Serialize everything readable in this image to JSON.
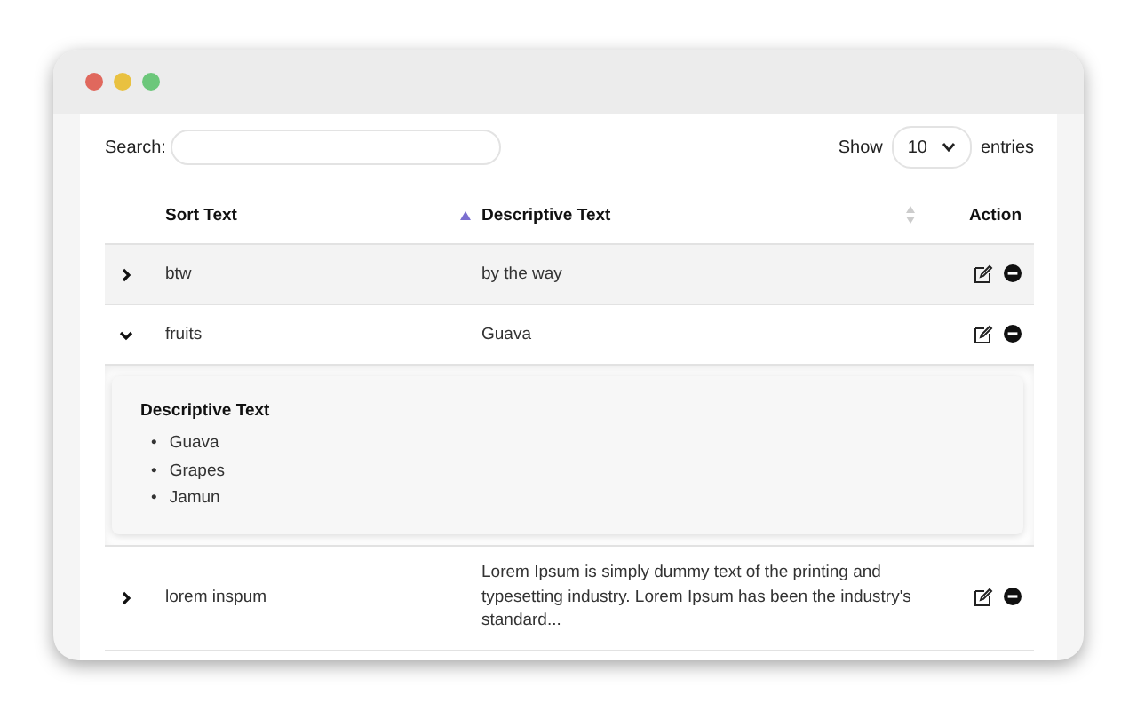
{
  "search": {
    "label": "Search:"
  },
  "page_size": {
    "label_before": "Show",
    "value": "10",
    "label_after": "entries"
  },
  "table": {
    "columns": [
      {
        "label": "Sort Text",
        "sortable": true,
        "sorted": true
      },
      {
        "label": "Descriptive Text",
        "sortable": true,
        "sorted": false
      },
      {
        "label": "Action",
        "sortable": false,
        "sorted": false
      }
    ],
    "rows": [
      {
        "sort_text": "btw",
        "descriptive_text": "by the way",
        "expanded": false,
        "striped": true
      },
      {
        "sort_text": "fruits",
        "descriptive_text": "Guava",
        "expanded": true,
        "striped": false,
        "detail": {
          "title": "Descriptive Text",
          "bullet": "•",
          "items": [
            "Guava",
            "Grapes",
            "Jamun"
          ]
        }
      },
      {
        "sort_text": "lorem inspum",
        "descriptive_text": "Lorem Ipsum is simply dummy text of the printing and typesetting industry. Lorem Ipsum has been the industry's standard...",
        "expanded": false,
        "striped": false
      }
    ]
  }
}
